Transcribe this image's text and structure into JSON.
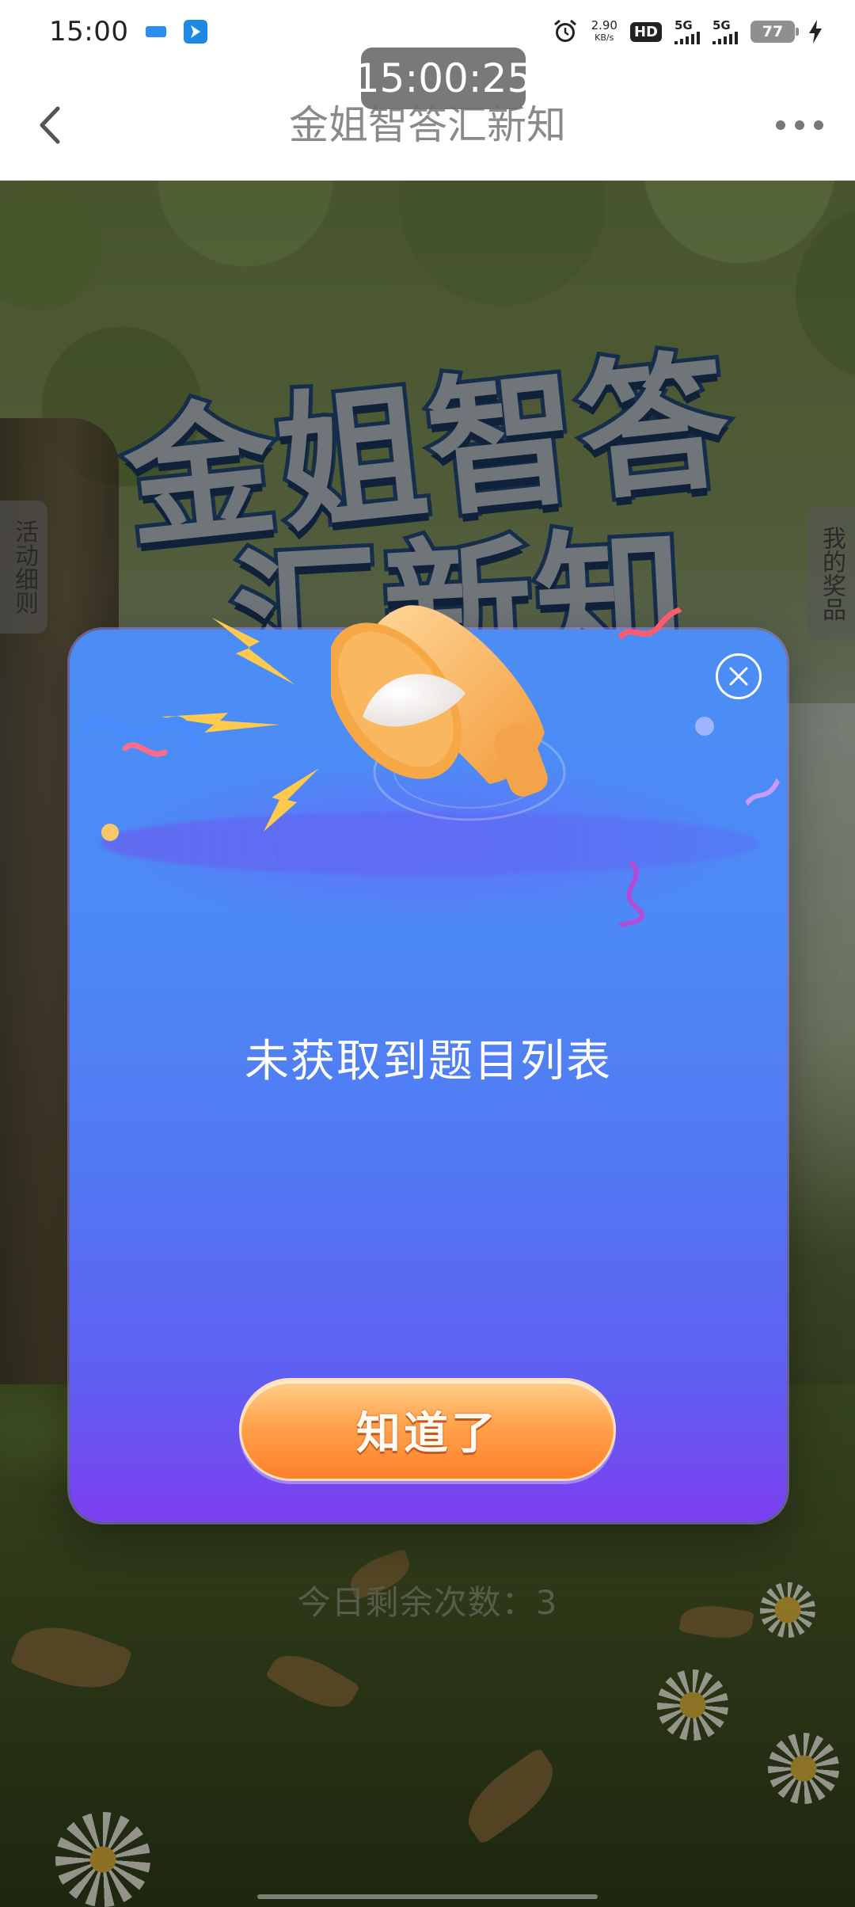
{
  "status_bar": {
    "time": "15:00",
    "net_speed": "2.90",
    "net_unit": "KB/s",
    "hd_label": "HD",
    "sim1_label": "5G",
    "sim2_label": "5G",
    "battery": "77"
  },
  "overlay_time": "15:00:25",
  "header": {
    "title": "金姐智答汇新知"
  },
  "hero": {
    "line1": "金姐智答",
    "line2": "汇新知"
  },
  "side_tabs": {
    "left": "活动细则",
    "right": "我的奖品"
  },
  "modal": {
    "message": "未获取到题目列表",
    "confirm_label": "知道了"
  },
  "remaining_label": "今日剩余次数：3",
  "colors": {
    "modal_top": "#4c8df5",
    "modal_bottom": "#7c3ff0",
    "button_orange": "#ff7f2a"
  }
}
